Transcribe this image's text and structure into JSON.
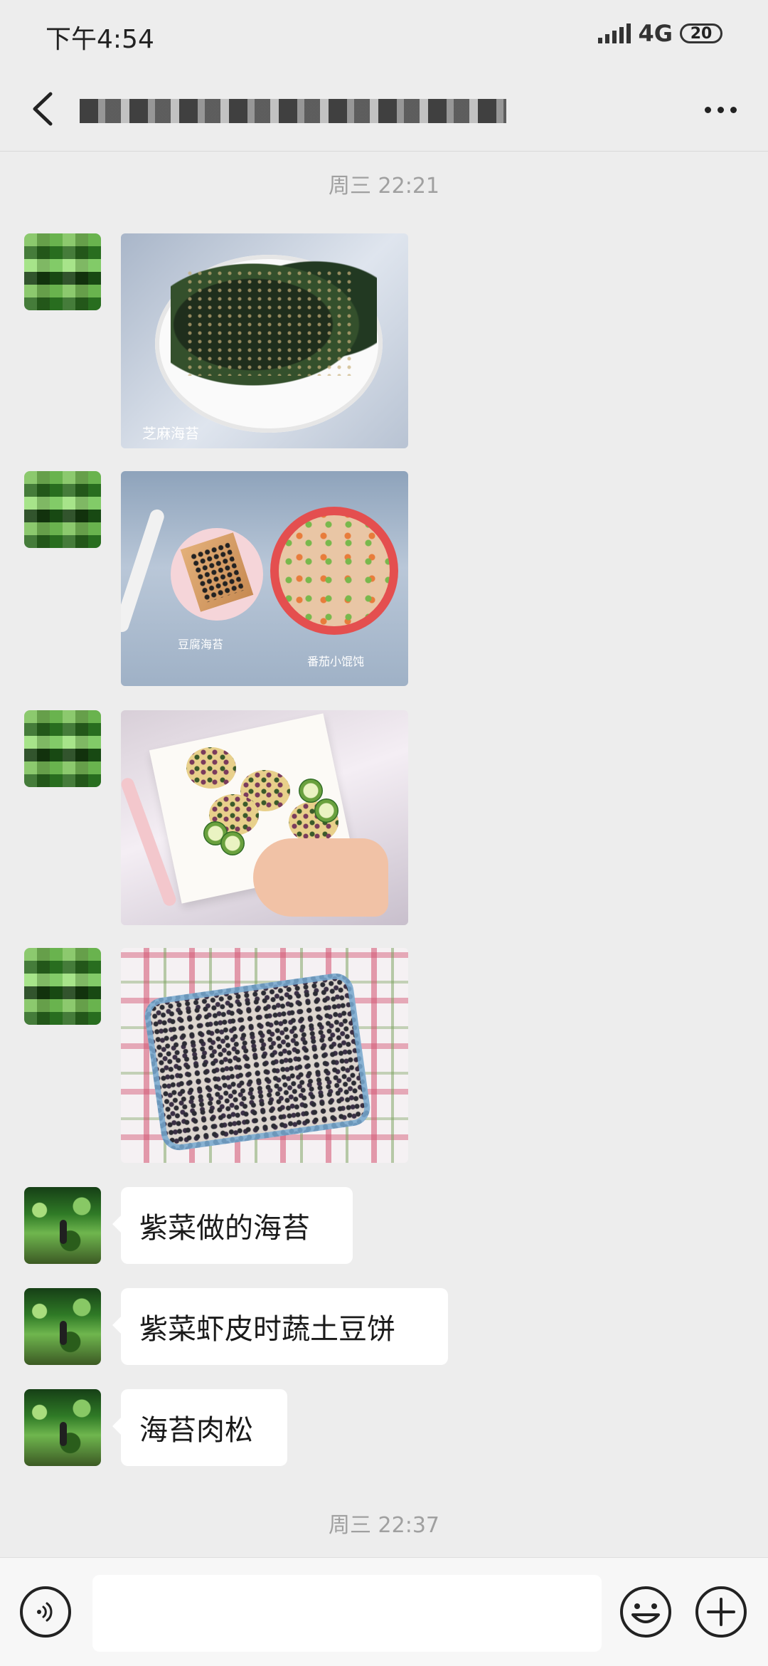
{
  "status_bar": {
    "time": "下午4:54",
    "network": "4G",
    "battery": "20"
  },
  "header": {
    "title": "",
    "back_icon": "back-arrow-icon",
    "more_icon": "more-dots-icon"
  },
  "messages": {
    "timestamp_top": "周三 22:21",
    "photos": [
      {
        "caption": "芝麻海苔"
      },
      {
        "caption_left": "豆腐海苔",
        "caption_right": "番茄小馄饨"
      },
      {},
      {}
    ],
    "texts": [
      "紫菜做的海苔",
      "紫菜虾皮时蔬土豆饼",
      "海苔肉松"
    ],
    "timestamp_bottom": "周三 22:37"
  },
  "input_bar": {
    "voice_icon": "voice-icon",
    "emoji_icon": "emoji-icon",
    "plus_icon": "plus-icon",
    "placeholder": ""
  },
  "colors": {
    "background": "#ededed",
    "bubble": "#ffffff",
    "timestamp": "#a0a0a0"
  }
}
